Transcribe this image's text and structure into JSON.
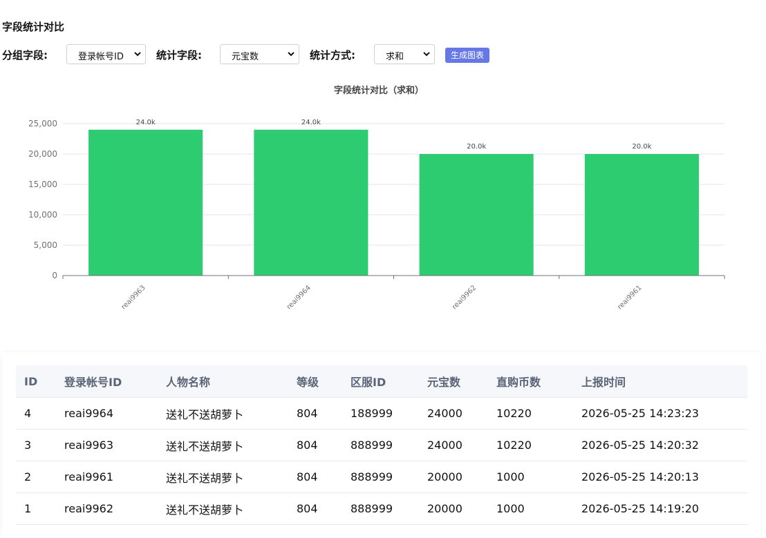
{
  "page": {
    "title": "字段统计对比"
  },
  "controls": {
    "group_label": "分组字段:",
    "group_value": "登录帐号ID",
    "stat_label": "统计字段:",
    "stat_value": "元宝数",
    "method_label": "统计方式:",
    "method_value": "求和",
    "generate_label": "生成图表"
  },
  "chart_data": {
    "type": "bar",
    "title": "字段统计对比（求和）",
    "categories": [
      "reai9963",
      "reai9964",
      "reai9962",
      "reai9961"
    ],
    "values": [
      24000,
      24000,
      20000,
      20000
    ],
    "data_labels": [
      "24.0k",
      "24.0k",
      "20.0k",
      "20.0k"
    ],
    "y_ticks": [
      0,
      5000,
      10000,
      15000,
      20000,
      25000
    ],
    "y_tick_labels": [
      "0",
      "5,000",
      "10,000",
      "15,000",
      "20,000",
      "25,000"
    ],
    "ylim": [
      0,
      25000
    ],
    "color": "#2ecc71",
    "grid": true
  },
  "table": {
    "headers": [
      "ID",
      "登录帐号ID",
      "人物名称",
      "等级",
      "区服ID",
      "元宝数",
      "直购币数",
      "上报时间"
    ],
    "rows": [
      [
        "4",
        "reai9964",
        "送礼不送胡萝卜",
        "804",
        "188999",
        "24000",
        "10220",
        "2026-05-25 14:23:23"
      ],
      [
        "3",
        "reai9963",
        "送礼不送胡萝卜",
        "804",
        "888999",
        "24000",
        "10220",
        "2026-05-25 14:20:32"
      ],
      [
        "2",
        "reai9961",
        "送礼不送胡萝卜",
        "804",
        "888999",
        "20000",
        "1000",
        "2026-05-25 14:20:13"
      ],
      [
        "1",
        "reai9962",
        "送礼不送胡萝卜",
        "804",
        "888999",
        "20000",
        "1000",
        "2026-05-25 14:19:20"
      ]
    ]
  }
}
